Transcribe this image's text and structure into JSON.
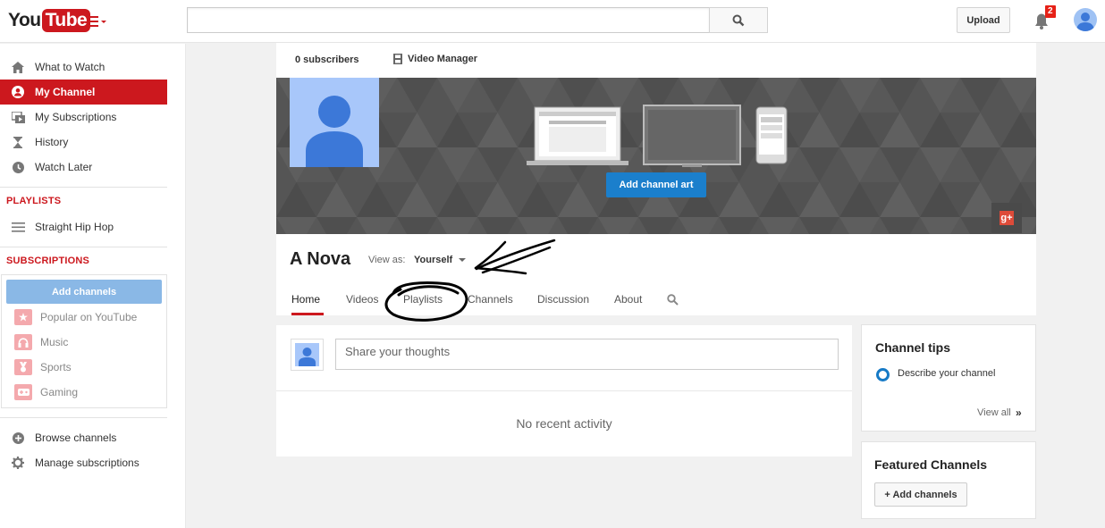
{
  "header": {
    "logo_you": "You",
    "logo_tube": "Tube",
    "search_placeholder": "",
    "upload_label": "Upload",
    "notification_count": "2"
  },
  "sidebar": {
    "items": [
      {
        "label": "What to Watch",
        "icon": "home-icon"
      },
      {
        "label": "My Channel",
        "icon": "user-circle-icon"
      },
      {
        "label": "My Subscriptions",
        "icon": "subscriptions-icon"
      },
      {
        "label": "History",
        "icon": "hourglass-icon"
      },
      {
        "label": "Watch Later",
        "icon": "clock-icon"
      }
    ],
    "playlists_heading": "PLAYLISTS",
    "playlists": [
      {
        "label": "Straight Hip Hop",
        "icon": "playlist-icon"
      }
    ],
    "subscriptions_heading": "SUBSCRIPTIONS",
    "add_channels_label": "Add channels",
    "subscriptions": [
      {
        "label": "Popular on YouTube",
        "icon": "star-icon"
      },
      {
        "label": "Music",
        "icon": "headphones-icon"
      },
      {
        "label": "Sports",
        "icon": "medal-icon"
      },
      {
        "label": "Gaming",
        "icon": "gamepad-icon"
      }
    ],
    "footer": [
      {
        "label": "Browse channels",
        "icon": "plus-circle-icon"
      },
      {
        "label": "Manage subscriptions",
        "icon": "gear-icon"
      }
    ]
  },
  "channel": {
    "subscribers": "0 subscribers",
    "video_manager": "Video Manager",
    "add_art_label": "Add channel art",
    "gplus_label": "g+",
    "name": "A Nova",
    "view_as_label": "View as:",
    "view_as_value": "Yourself",
    "tabs": [
      "Home",
      "Videos",
      "Playlists",
      "Channels",
      "Discussion",
      "About"
    ]
  },
  "activity": {
    "share_placeholder": "Share your thoughts",
    "empty_text": "No recent activity"
  },
  "tips": {
    "title": "Channel tips",
    "item": "Describe your channel",
    "view_all": "View all",
    "arrow": "»"
  },
  "featured": {
    "title": "Featured Channels",
    "button": "+ Add channels"
  },
  "colors": {
    "brand_red": "#cc181e",
    "blue_button": "#1b7fcc",
    "light_blue": "#8ab8e6"
  }
}
